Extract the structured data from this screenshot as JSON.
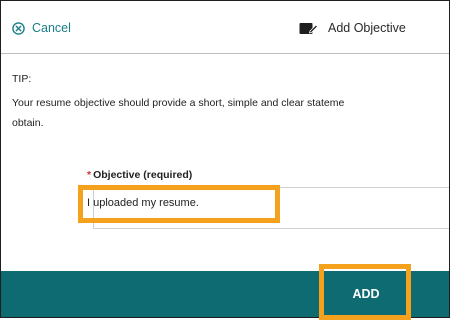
{
  "header": {
    "cancel_label": "Cancel",
    "title": "Add Objective"
  },
  "tip": {
    "heading": "TIP:",
    "line1": "Your resume objective should provide a short, simple and clear stateme",
    "line2": "obtain."
  },
  "form": {
    "required_mark": "*",
    "label": "Objective (required)",
    "value": "I uploaded my resume."
  },
  "footer": {
    "add_label": "ADD"
  },
  "colors": {
    "accent": "#1a7f86",
    "footer": "#0f6b72",
    "highlight": "#f4a21e",
    "required": "#d32f2f"
  }
}
